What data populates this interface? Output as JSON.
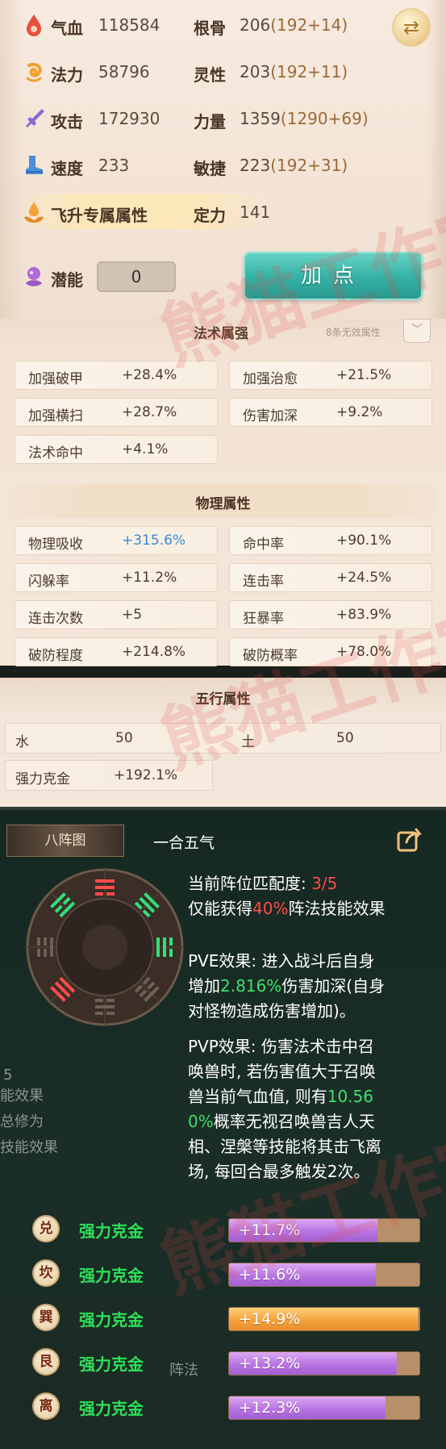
{
  "attributes": {
    "left": [
      {
        "icon": "blood-drop-icon",
        "label": "气血",
        "value": "118584"
      },
      {
        "icon": "mana-swirl-icon",
        "label": "法力",
        "value": "58796"
      },
      {
        "icon": "sword-icon",
        "label": "攻击",
        "value": "172930"
      },
      {
        "icon": "boot-icon",
        "label": "速度",
        "value": "233"
      }
    ],
    "right": [
      {
        "label": "根骨",
        "value": "206",
        "detail": "(192+14)"
      },
      {
        "label": "灵性",
        "value": "203",
        "detail": "(192+11)"
      },
      {
        "label": "力量",
        "value": "1359",
        "detail": "(1290+69)"
      },
      {
        "label": "敏捷",
        "value": "223",
        "detail": "(192+31)"
      }
    ],
    "ascend_label": "飞升专属属性",
    "dingli_label": "定力",
    "dingli_value": "141",
    "potential_label": "潜能",
    "potential_value": "0",
    "add_point_label": "加点"
  },
  "magic": {
    "title": "法术属强",
    "hint": "8条无效属性",
    "items": [
      {
        "label": "加强破甲",
        "value": "+28.4%"
      },
      {
        "label": "加强治愈",
        "value": "+21.5%"
      },
      {
        "label": "加强横扫",
        "value": "+28.7%"
      },
      {
        "label": "伤害加深",
        "value": "+9.2%"
      },
      {
        "label": "法术命中",
        "value": "+4.1%"
      }
    ]
  },
  "physical": {
    "title": "物理属性",
    "items": [
      {
        "label": "物理吸收",
        "value": "+315.6%"
      },
      {
        "label": "命中率",
        "value": "+90.1%"
      },
      {
        "label": "闪躲率",
        "value": "+11.2%"
      },
      {
        "label": "连击率",
        "value": "+24.5%"
      },
      {
        "label": "连击次数",
        "value": "+5"
      },
      {
        "label": "狂暴率",
        "value": "+83.9%"
      },
      {
        "label": "破防程度",
        "value": "+214.8%"
      },
      {
        "label": "破防概率",
        "value": "+78.0%"
      }
    ]
  },
  "elements": {
    "title": "五行属性",
    "water_label": "水",
    "water_value": "50",
    "earth_label": "土",
    "earth_value": "50",
    "metal_label": "强力克金",
    "metal_value": "+192.1%"
  },
  "formation": {
    "tab_label": "八阵图",
    "name": "一合五气",
    "match_label": "当前阵位匹配度:",
    "match_value": "3/5",
    "effect_prefix": "仅能获得",
    "effect_pct": "40%",
    "effect_suffix": "阵法技能效果",
    "pve_1": "PVE效果: 进入战斗后自身",
    "pve_2a": "增加",
    "pve_2b": "2.816%",
    "pve_2c": "伤害加深(自身",
    "pve_3": "对怪物造成伤害增加)。",
    "pvp_1": "PVP效果: 伤害法术击中召",
    "pvp_2": "唤兽时, 若伤害值大于召唤",
    "pvp_3a": "兽当前气血值, 则有",
    "pvp_3b": "10.56",
    "pvp_4a": "0%",
    "pvp_4b": "概率无视召唤兽吉人天",
    "pvp_5": "相、涅槃等技能将其击飞离",
    "pvp_6": "场, 每回合最多触发2次。",
    "ghost_1": "5",
    "ghost_2": "能效果",
    "ghost_3": "总修为",
    "ghost_4": "技能效果",
    "ghost_5": "阵法",
    "bonuses": [
      {
        "badge": "兑",
        "name": "强力克金",
        "value": "+11.7%",
        "fill": 0.78,
        "color": "purple"
      },
      {
        "badge": "坎",
        "name": "强力克金",
        "value": "+11.6%",
        "fill": 0.77,
        "color": "purple"
      },
      {
        "badge": "巽",
        "name": "强力克金",
        "value": "+14.9%",
        "fill": 0.99,
        "color": "orange"
      },
      {
        "badge": "艮",
        "name": "强力克金",
        "value": "+13.2%",
        "fill": 0.88,
        "color": "purple"
      },
      {
        "badge": "离",
        "name": "强力克金",
        "value": "+12.3%",
        "fill": 0.82,
        "color": "purple"
      }
    ]
  },
  "watermark": "熊猫工作室"
}
